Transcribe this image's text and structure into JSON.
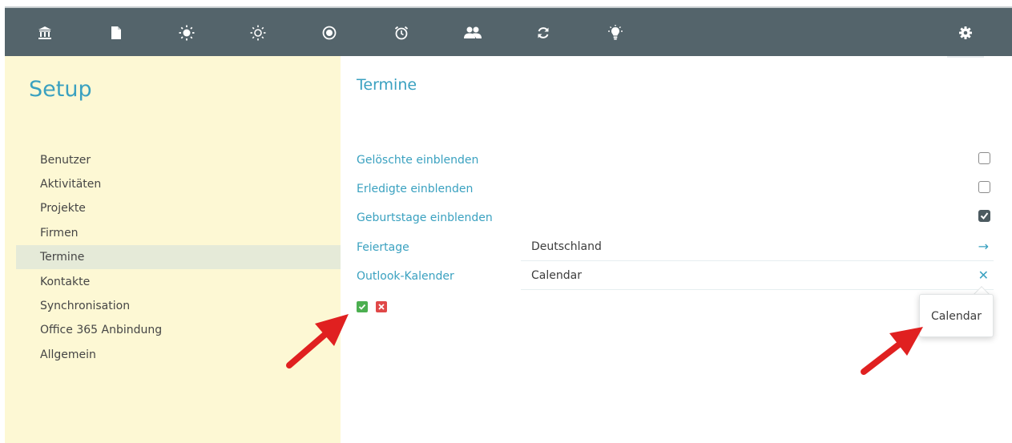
{
  "topbar": {
    "icons": [
      "bank-icon",
      "document-icon",
      "sun-icon",
      "sun-outline-icon",
      "radio-icon",
      "alarm-clock-icon",
      "users-icon",
      "sync-icon",
      "lightbulb-icon",
      "gear-icon"
    ]
  },
  "sidebar": {
    "title": "Setup",
    "items": [
      {
        "label": "Benutzer"
      },
      {
        "label": "Aktivitäten"
      },
      {
        "label": "Projekte"
      },
      {
        "label": "Firmen"
      },
      {
        "label": "Termine",
        "active": true
      },
      {
        "label": "Kontakte"
      },
      {
        "label": "Synchronisation"
      },
      {
        "label": "Office 365 Anbindung"
      },
      {
        "label": "Allgemein"
      }
    ]
  },
  "main": {
    "title": "Termine",
    "options": [
      {
        "label": "Gelöschte einblenden",
        "checked": false
      },
      {
        "label": "Erledigte einblenden",
        "checked": false
      },
      {
        "label": "Geburtstage einblenden",
        "checked": true
      }
    ],
    "fields": [
      {
        "label": "Feiertage",
        "value": "Deutschland",
        "action": "→"
      },
      {
        "label": "Outlook-Kalender",
        "value": "Calendar",
        "action": "✕"
      }
    ],
    "dropdown_option": "Calendar"
  },
  "colors": {
    "topbar": "#54646b",
    "sidebar": "#fdf8d4",
    "accent": "#3aa1c0",
    "confirm": "#4caf50",
    "cancel": "#e04848",
    "arrow": "#e02020"
  }
}
